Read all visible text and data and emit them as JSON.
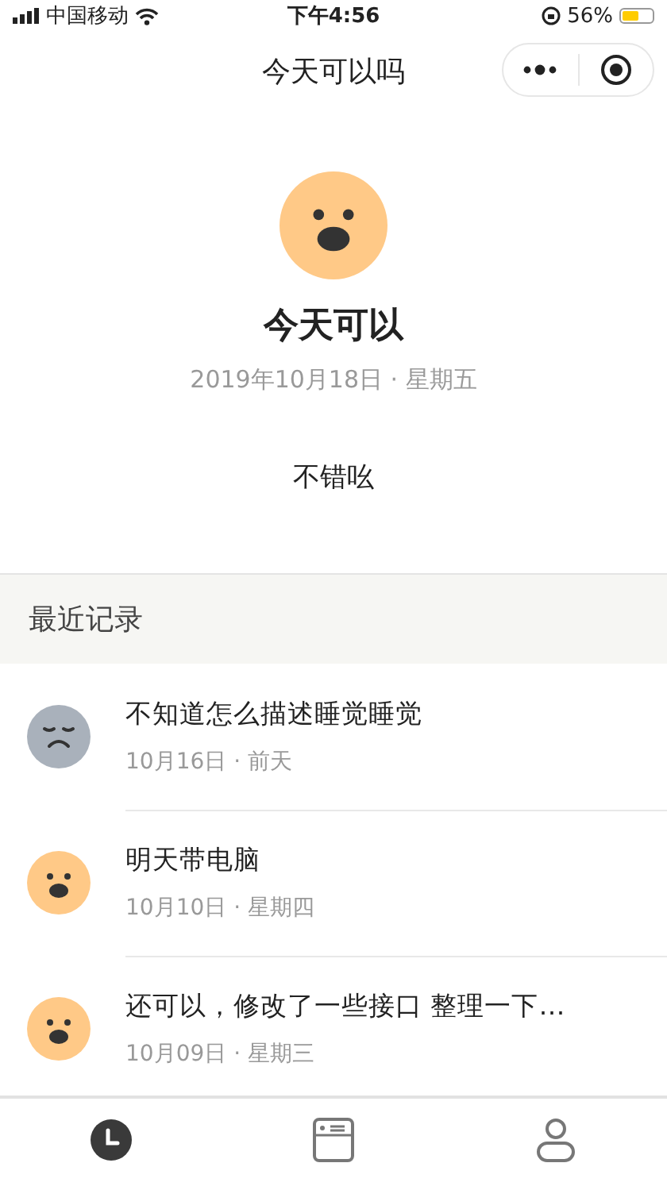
{
  "status_bar": {
    "carrier": "中国移动",
    "time": "下午4:56",
    "battery": "56%"
  },
  "nav": {
    "title": "今天可以吗"
  },
  "today": {
    "kind": "happy",
    "headline": "今天可以",
    "date": "2019年10月18日 · 星期五",
    "note": "不错吆"
  },
  "section": {
    "title": "最近记录"
  },
  "records": [
    {
      "kind": "sad",
      "text": "不知道怎么描述睡觉睡觉",
      "date": "10月16日 · 前天"
    },
    {
      "kind": "happy",
      "text": "明天带电脑",
      "date": "10月10日 · 星期四"
    },
    {
      "kind": "happy",
      "text": "还可以，修改了一些接口 整理一下…",
      "date": "10月09日 · 星期三"
    }
  ],
  "tabs": [
    {
      "kind": "history",
      "selected": true
    },
    {
      "kind": "calendar",
      "selected": false
    },
    {
      "kind": "profile",
      "selected": false
    }
  ]
}
